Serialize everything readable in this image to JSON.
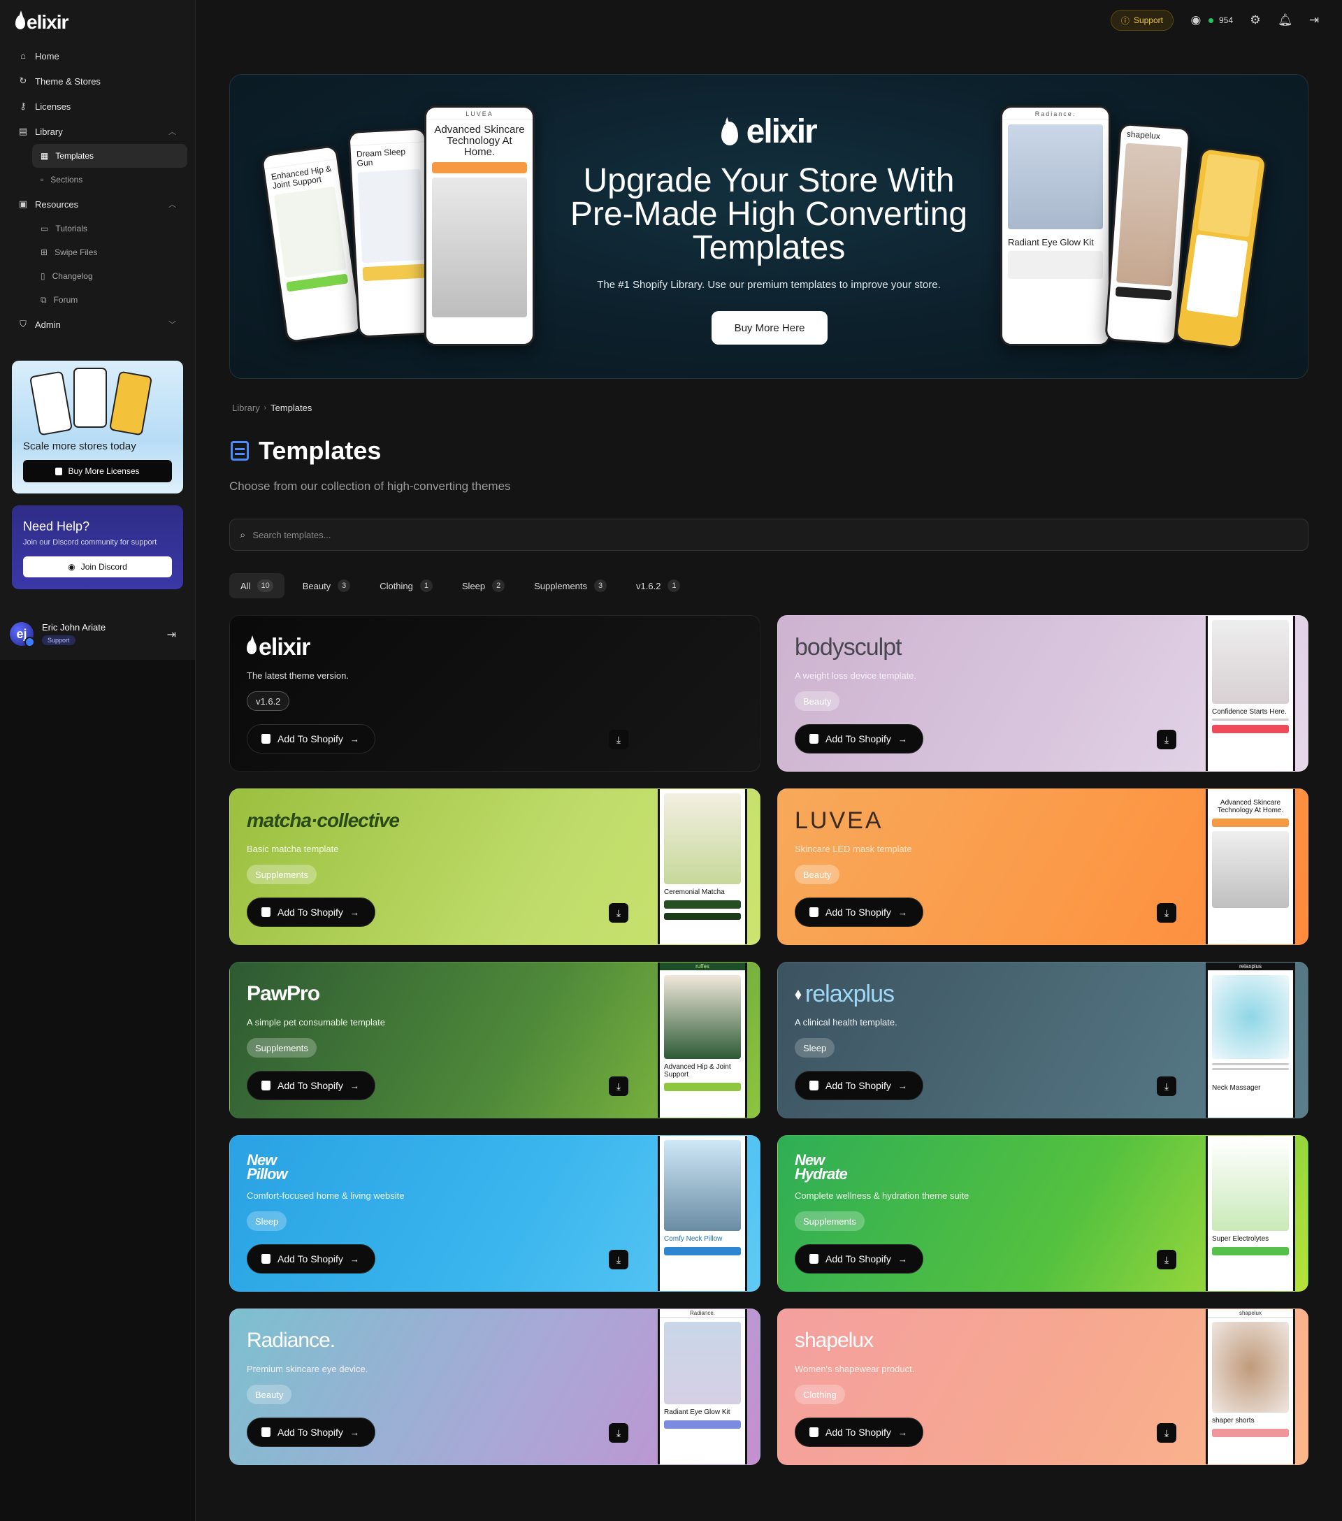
{
  "app": {
    "logo": "elixir"
  },
  "sidebar": {
    "nav": [
      {
        "label": "Home",
        "icon": "home-icon"
      },
      {
        "label": "Theme & Stores",
        "icon": "refresh-icon"
      },
      {
        "label": "Licenses",
        "icon": "key-icon"
      },
      {
        "label": "Library",
        "icon": "book-icon"
      },
      {
        "label": "Resources",
        "icon": "folder-icon"
      },
      {
        "label": "Admin",
        "icon": "shield-icon"
      }
    ],
    "library_sub": [
      "Templates",
      "Sections"
    ],
    "resources_sub": [
      "Tutorials",
      "Swipe Files",
      "Changelog",
      "Forum"
    ],
    "promo": {
      "text": "Scale more stores today",
      "button": "Buy More Licenses"
    },
    "help": {
      "title": "Need Help?",
      "subtitle": "Join our Discord community for support",
      "button": "Join Discord"
    },
    "user": {
      "name": "Eric John Ariate",
      "initials": "ej",
      "role": "Support"
    }
  },
  "topbar": {
    "support": "Support",
    "discord_count": "954"
  },
  "hero": {
    "logo": "elixir",
    "title_line1": "Upgrade Your Store With",
    "title_line2": "Pre-Made High Converting",
    "title_line3": "Templates",
    "subtitle": "The #1 Shopify Library. Use our premium templates to improve your store.",
    "button": "Buy More Here",
    "phones": [
      "Enhanced Hip & Joint Support",
      "Dream Sleep Gun",
      "Advanced Skincare Technology At Home.",
      "Radiance.",
      "shapelux",
      "Radiant Eye Glow Kit"
    ]
  },
  "breadcrumb": {
    "parent": "Library",
    "current": "Templates"
  },
  "page": {
    "title": "Templates",
    "subtitle": "Choose from our collection of high-converting themes",
    "search_placeholder": "Search templates..."
  },
  "filters": [
    {
      "label": "All",
      "count": "10"
    },
    {
      "label": "Beauty",
      "count": "3"
    },
    {
      "label": "Clothing",
      "count": "1"
    },
    {
      "label": "Sleep",
      "count": "2"
    },
    {
      "label": "Supplements",
      "count": "3"
    },
    {
      "label": "v1.6.2",
      "count": "1"
    }
  ],
  "add_label": "Add To Shopify",
  "cards": [
    {
      "brand": "elixir",
      "desc": "The latest theme version.",
      "tag": "v1.6.2"
    },
    {
      "brand": "bodysculpt",
      "desc": "A weight loss device template.",
      "tag": "Beauty",
      "shot_title": "Confidence Starts Here."
    },
    {
      "brand": "matcha·collective",
      "desc": "Basic matcha template",
      "tag": "Supplements",
      "shot_title": "Ceremonial Matcha"
    },
    {
      "brand": "LUVEA",
      "desc": "Skincare LED mask template",
      "tag": "Beauty",
      "shot_title": "Advanced Skincare Technology At Home."
    },
    {
      "brand": "PawPro",
      "desc": "A simple pet consumable template",
      "tag": "Supplements",
      "shot_title": "Advanced Hip & Joint Support"
    },
    {
      "brand": "relaxplus",
      "desc": "A clinical health template.",
      "tag": "Sleep",
      "shot_title": "Neck Massager"
    },
    {
      "brand": "New Pillow",
      "desc": "Comfort-focused home & living website",
      "tag": "Sleep",
      "shot_title": "Comfy Neck Pillow"
    },
    {
      "brand": "New Hydrate",
      "desc": "Complete wellness & hydration theme suite",
      "tag": "Supplements",
      "shot_title": "Super Electrolytes"
    },
    {
      "brand": "Radiance.",
      "desc": "Premium skincare eye device.",
      "tag": "Beauty",
      "shot_title": "Radiant Eye Glow Kit"
    },
    {
      "brand": "shapelux",
      "desc": "Women's shapewear product.",
      "tag": "Clothing",
      "shot_title": "shaper shorts"
    }
  ],
  "colors": {
    "accent": "#4a8cff",
    "support": "#f3c53a",
    "online": "#22c55e"
  }
}
